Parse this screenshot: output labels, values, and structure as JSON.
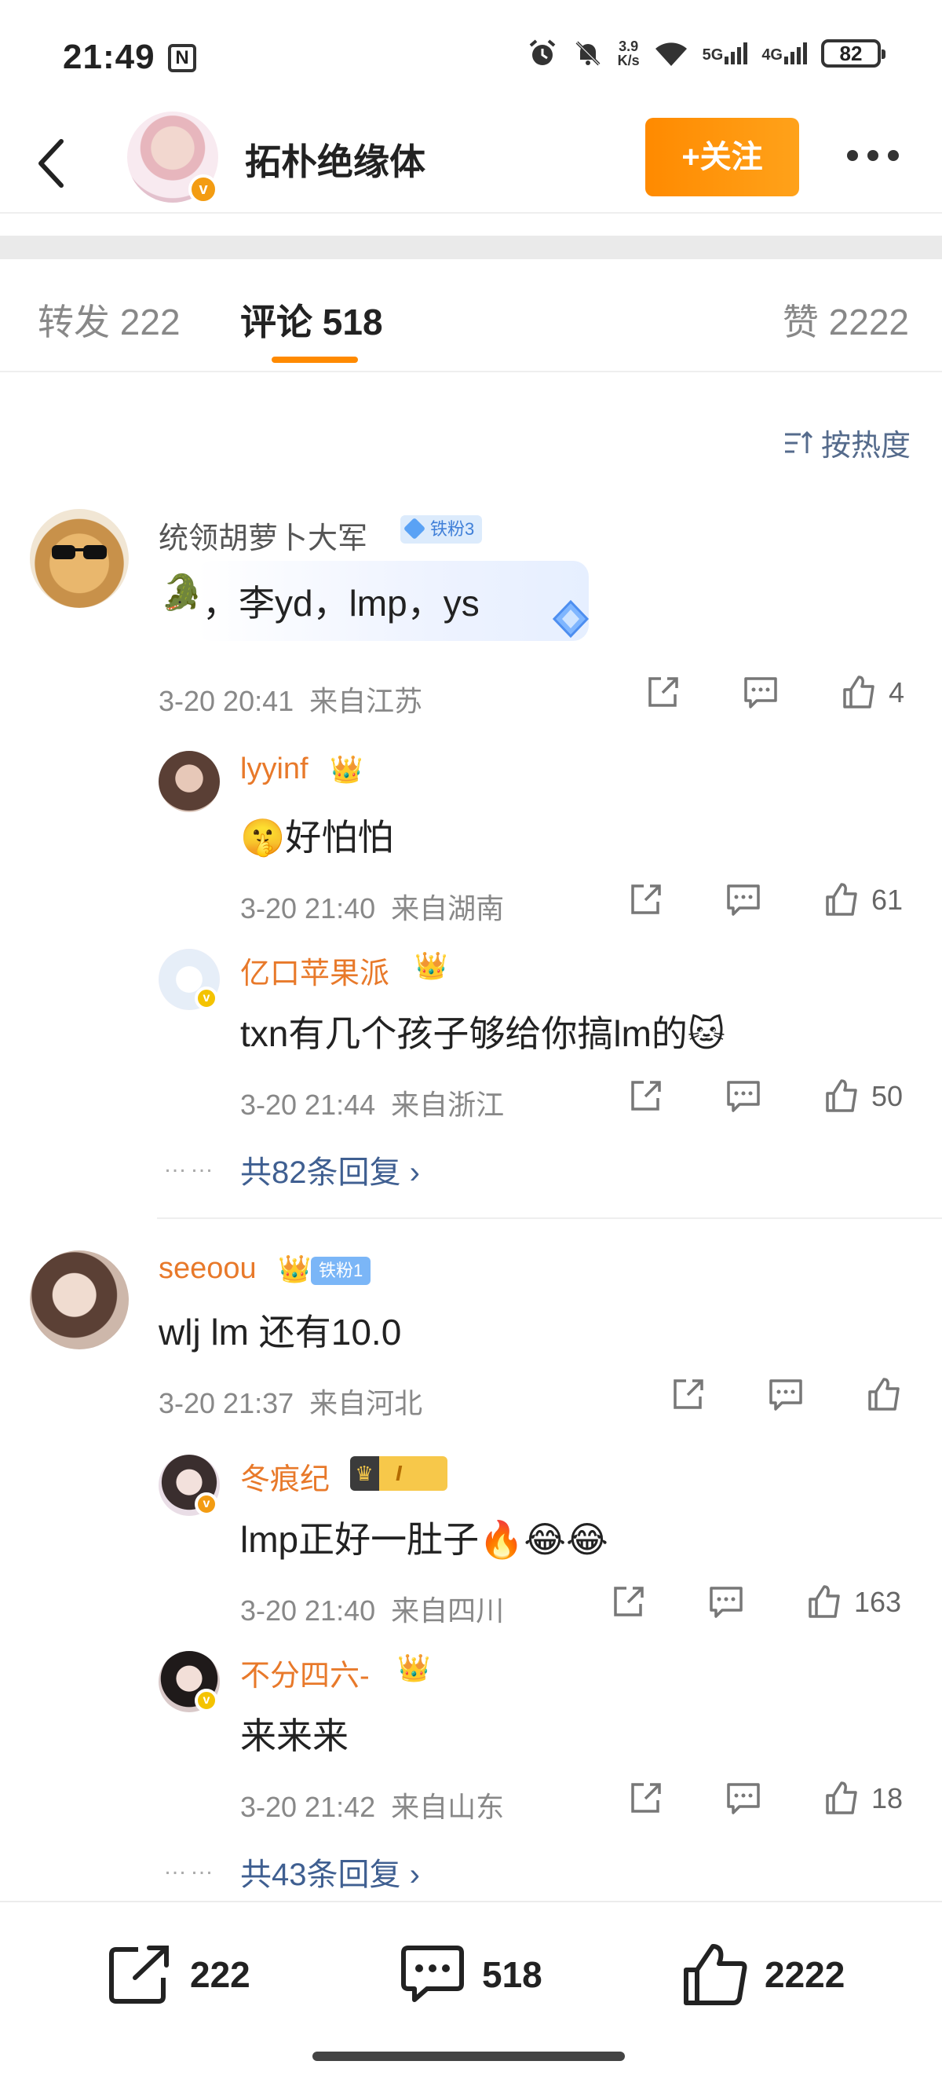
{
  "status": {
    "time": "21:49",
    "net_speed_top": "3.9",
    "net_speed_bottom": "K/s",
    "sig1": "5G",
    "sig2": "4G",
    "battery": "82"
  },
  "header": {
    "title": "拓朴绝缘体",
    "follow_label": "+关注"
  },
  "tabs": [
    {
      "label": "转发 222"
    },
    {
      "label": "评论 518"
    },
    {
      "label": "赞 2222"
    }
  ],
  "sort_label": "按热度",
  "comments": [
    {
      "user": "统领胡萝卜大军",
      "fan_badge": "铁粉3",
      "text": "，李yd，lmp，ys",
      "time": "3-20 20:41",
      "location": "来自江苏",
      "likes": "4",
      "replies": [
        {
          "user": "lyyinf",
          "text": "好怕怕",
          "time": "3-20 21:40",
          "location": "来自湖南",
          "likes": "61"
        },
        {
          "user": "亿口苹果派",
          "text": "txn有几个孩子够给你搞lm的",
          "time": "3-20 21:44",
          "location": "来自浙江",
          "likes": "50"
        }
      ],
      "more_replies": "共82条回复 ›"
    },
    {
      "user": "seeoou",
      "fan_badge": "铁粉1",
      "text": "wlj  lm 还有10.0",
      "time": "3-20 21:37",
      "location": "来自河北",
      "likes": "",
      "replies": [
        {
          "user": "冬痕纪",
          "level_badge": "I",
          "text": "lmp正好一肚子🔥😂😂",
          "time": "3-20 21:40",
          "location": "来自四川",
          "likes": "163"
        },
        {
          "user": "不分四六-",
          "text": "来来来",
          "time": "3-20 21:42",
          "location": "来自山东",
          "likes": "18"
        }
      ],
      "more_replies": "共43条回复 ›"
    }
  ],
  "bottom_bar": {
    "repost": "222",
    "comment": "518",
    "like": "2222"
  },
  "colors": {
    "accent": "#ff8a00",
    "name_orange": "#e8792a",
    "link_blue": "#3f5f91"
  }
}
